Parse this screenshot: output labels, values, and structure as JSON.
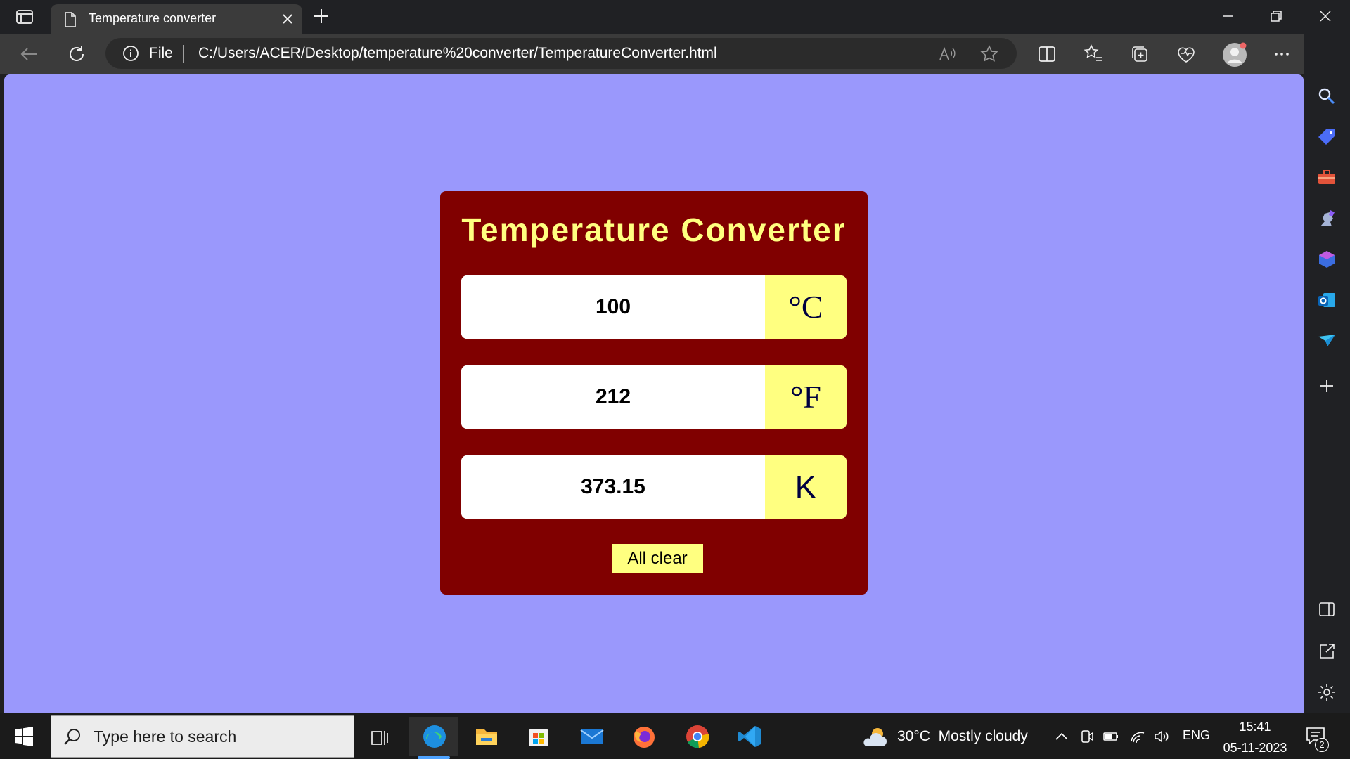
{
  "browser": {
    "tab_title": "Temperature converter",
    "address": {
      "scheme_label": "File",
      "url": "C:/Users/ACER/Desktop/temperature%20converter/TemperatureConverter.html"
    }
  },
  "page": {
    "title": "Temperature Converter",
    "celsius": {
      "value": "100",
      "unit": "°C"
    },
    "fahrenheit": {
      "value": "212",
      "unit": "°F"
    },
    "kelvin": {
      "value": "373.15",
      "unit": "K"
    },
    "clear_label": "All clear",
    "colors": {
      "background": "#9a98fc",
      "panel": "#800000",
      "accent": "#ffff80"
    }
  },
  "taskbar": {
    "search_placeholder": "Type here to search",
    "weather": {
      "temp": "30°C",
      "condition": "Mostly cloudy"
    },
    "language": "ENG",
    "time": "15:41",
    "date": "05-11-2023",
    "notification_count": "2",
    "apps": [
      "edge-icon",
      "file-explorer-icon",
      "microsoft-store-icon",
      "mail-icon",
      "firefox-icon",
      "chrome-icon",
      "vscode-icon"
    ]
  }
}
